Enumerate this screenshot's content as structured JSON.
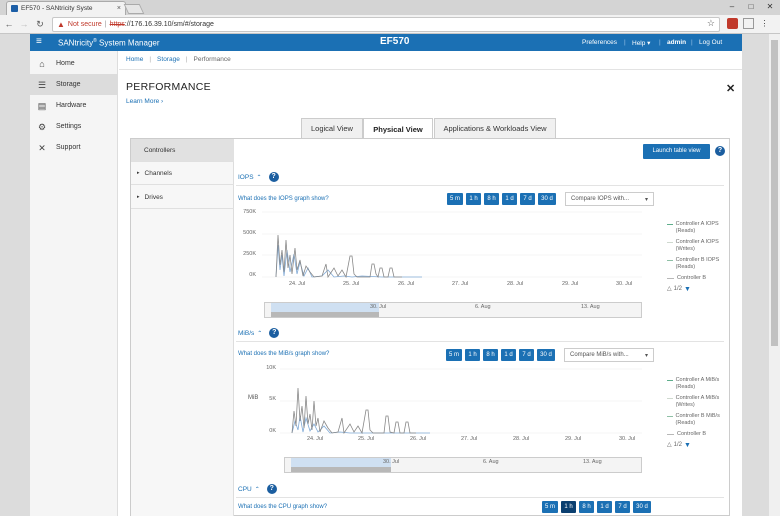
{
  "browser": {
    "tab_title": "EF570 - SANtricity Syste",
    "tab_close": "×",
    "address": {
      "warning": "Not secure",
      "separator": "|",
      "scheme": "https",
      "rest": "://176.16.39.10/sm/#/storage"
    }
  },
  "app": {
    "brand": "SANtricity",
    "brand_reg": "®",
    "brand_suffix": " System Manager",
    "model": "EF570",
    "nav": {
      "preferences": "Preferences",
      "help": "Help ▾",
      "user": "admin",
      "logout": "Log Out",
      "sep": "|"
    }
  },
  "sidebar": {
    "items": [
      {
        "label": "Home",
        "icon": "home-icon"
      },
      {
        "label": "Storage",
        "icon": "storage-icon"
      },
      {
        "label": "Hardware",
        "icon": "hardware-icon"
      },
      {
        "label": "Settings",
        "icon": "gear-icon"
      },
      {
        "label": "Support",
        "icon": "tools-icon"
      }
    ],
    "active_index": 1
  },
  "breadcrumb": [
    "Home",
    "Storage",
    "Performance"
  ],
  "page": {
    "title": "PERFORMANCE",
    "learn_more": "Learn More ›",
    "tabs": [
      "Logical View",
      "Physical View",
      "Applications & Workloads View"
    ],
    "active_tab": 1,
    "launch_table": "Launch table view"
  },
  "left_nav": [
    {
      "label": "Controllers",
      "caret": ""
    },
    {
      "label": "Channels",
      "caret": "▸"
    },
    {
      "label": "Drives",
      "caret": "▸"
    }
  ],
  "ranges": [
    "5 m",
    "1 h",
    "8 h",
    "1 d",
    "7 d",
    "30 d"
  ],
  "iops": {
    "title": "IOPS",
    "what": "What does the IOPS graph show?",
    "compare": "Compare IOPS with...",
    "y_ticks": [
      "750K",
      "500K",
      "250K",
      "0K"
    ],
    "x_ticks": [
      "24. Jul",
      "25. Jul",
      "26. Jul",
      "27. Jul",
      "28. Jul",
      "29. Jul",
      "30. Jul"
    ],
    "nav_ticks": [
      "30. Jul",
      "6. Aug",
      "13. Aug"
    ],
    "legend": [
      "Controller A IOPS (Reads)",
      "Controller A IOPS (Writes)",
      "Controller B IOPS (Reads)",
      "Controller B"
    ],
    "pager": "1/2"
  },
  "mibs": {
    "title": "MiB/s",
    "what": "What does the MiB/s graph show?",
    "compare": "Compare MiB/s with...",
    "y_label": "MiB",
    "y_ticks": [
      "10K",
      "5K",
      "0K"
    ],
    "x_ticks": [
      "24. Jul",
      "25. Jul",
      "26. Jul",
      "27. Jul",
      "28. Jul",
      "29. Jul",
      "30. Jul"
    ],
    "nav_ticks": [
      "30. Jul",
      "6. Aug",
      "13. Aug"
    ],
    "legend": [
      "Controller A MiB/s (Reads)",
      "Controller A MiB/s (Writes)",
      "Controller B MiB/s (Reads)",
      "Controller B"
    ],
    "pager": "1/2"
  },
  "cpu": {
    "title": "CPU",
    "what": "What does the CPU graph show?",
    "active_range": 1
  },
  "colors": {
    "brand_blue": "#1b70b4",
    "active_range": "#0b3f70",
    "series_a_reads": "#5fae8c",
    "series_a_writes": "#cfd9cf",
    "series_b_reads": "#8fc0a6",
    "series_b": "#b8b8b8",
    "line_main": "#888",
    "line_blue": "#7fa9d6"
  }
}
